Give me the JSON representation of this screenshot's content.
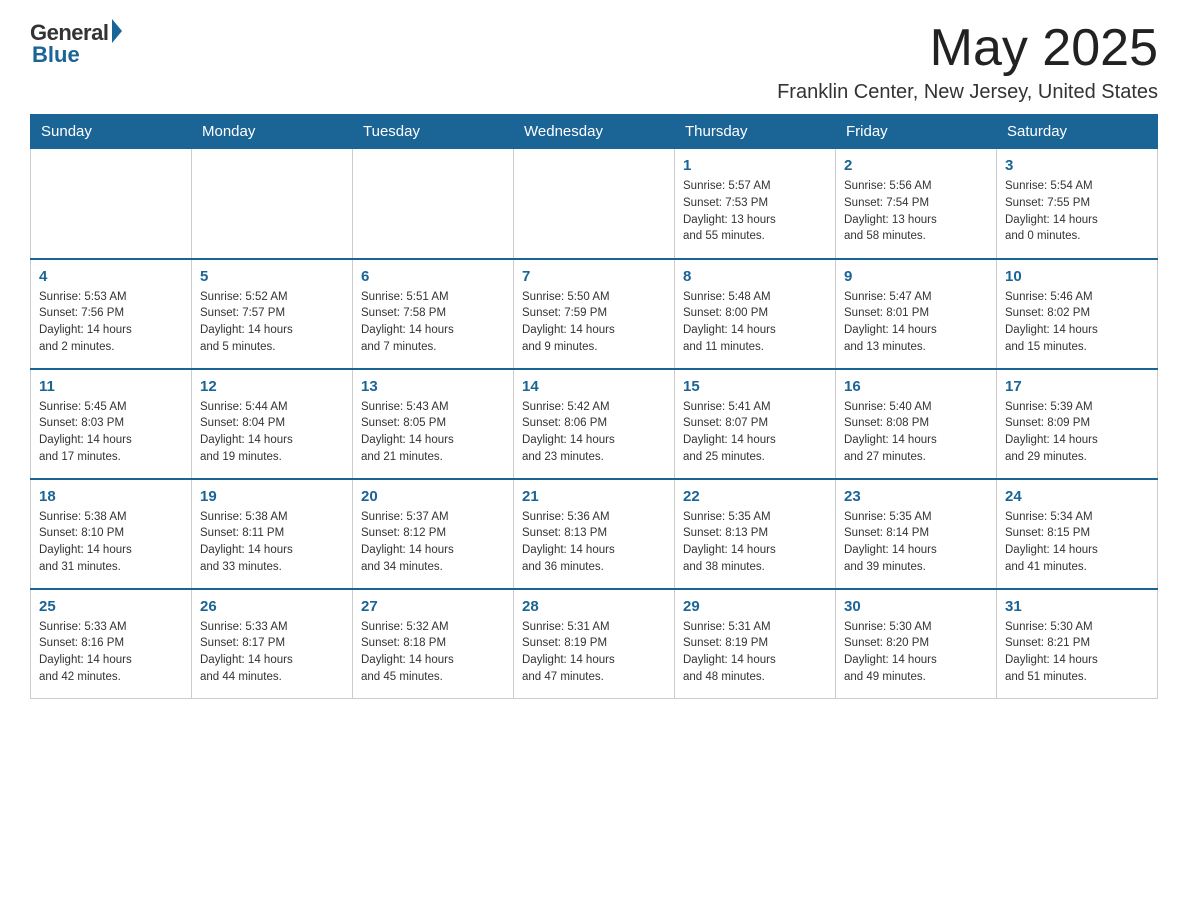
{
  "logo": {
    "general": "General",
    "blue": "Blue"
  },
  "title": {
    "month_year": "May 2025",
    "location": "Franklin Center, New Jersey, United States"
  },
  "headers": [
    "Sunday",
    "Monday",
    "Tuesday",
    "Wednesday",
    "Thursday",
    "Friday",
    "Saturday"
  ],
  "weeks": [
    [
      {
        "day": "",
        "info": ""
      },
      {
        "day": "",
        "info": ""
      },
      {
        "day": "",
        "info": ""
      },
      {
        "day": "",
        "info": ""
      },
      {
        "day": "1",
        "info": "Sunrise: 5:57 AM\nSunset: 7:53 PM\nDaylight: 13 hours\nand 55 minutes."
      },
      {
        "day": "2",
        "info": "Sunrise: 5:56 AM\nSunset: 7:54 PM\nDaylight: 13 hours\nand 58 minutes."
      },
      {
        "day": "3",
        "info": "Sunrise: 5:54 AM\nSunset: 7:55 PM\nDaylight: 14 hours\nand 0 minutes."
      }
    ],
    [
      {
        "day": "4",
        "info": "Sunrise: 5:53 AM\nSunset: 7:56 PM\nDaylight: 14 hours\nand 2 minutes."
      },
      {
        "day": "5",
        "info": "Sunrise: 5:52 AM\nSunset: 7:57 PM\nDaylight: 14 hours\nand 5 minutes."
      },
      {
        "day": "6",
        "info": "Sunrise: 5:51 AM\nSunset: 7:58 PM\nDaylight: 14 hours\nand 7 minutes."
      },
      {
        "day": "7",
        "info": "Sunrise: 5:50 AM\nSunset: 7:59 PM\nDaylight: 14 hours\nand 9 minutes."
      },
      {
        "day": "8",
        "info": "Sunrise: 5:48 AM\nSunset: 8:00 PM\nDaylight: 14 hours\nand 11 minutes."
      },
      {
        "day": "9",
        "info": "Sunrise: 5:47 AM\nSunset: 8:01 PM\nDaylight: 14 hours\nand 13 minutes."
      },
      {
        "day": "10",
        "info": "Sunrise: 5:46 AM\nSunset: 8:02 PM\nDaylight: 14 hours\nand 15 minutes."
      }
    ],
    [
      {
        "day": "11",
        "info": "Sunrise: 5:45 AM\nSunset: 8:03 PM\nDaylight: 14 hours\nand 17 minutes."
      },
      {
        "day": "12",
        "info": "Sunrise: 5:44 AM\nSunset: 8:04 PM\nDaylight: 14 hours\nand 19 minutes."
      },
      {
        "day": "13",
        "info": "Sunrise: 5:43 AM\nSunset: 8:05 PM\nDaylight: 14 hours\nand 21 minutes."
      },
      {
        "day": "14",
        "info": "Sunrise: 5:42 AM\nSunset: 8:06 PM\nDaylight: 14 hours\nand 23 minutes."
      },
      {
        "day": "15",
        "info": "Sunrise: 5:41 AM\nSunset: 8:07 PM\nDaylight: 14 hours\nand 25 minutes."
      },
      {
        "day": "16",
        "info": "Sunrise: 5:40 AM\nSunset: 8:08 PM\nDaylight: 14 hours\nand 27 minutes."
      },
      {
        "day": "17",
        "info": "Sunrise: 5:39 AM\nSunset: 8:09 PM\nDaylight: 14 hours\nand 29 minutes."
      }
    ],
    [
      {
        "day": "18",
        "info": "Sunrise: 5:38 AM\nSunset: 8:10 PM\nDaylight: 14 hours\nand 31 minutes."
      },
      {
        "day": "19",
        "info": "Sunrise: 5:38 AM\nSunset: 8:11 PM\nDaylight: 14 hours\nand 33 minutes."
      },
      {
        "day": "20",
        "info": "Sunrise: 5:37 AM\nSunset: 8:12 PM\nDaylight: 14 hours\nand 34 minutes."
      },
      {
        "day": "21",
        "info": "Sunrise: 5:36 AM\nSunset: 8:13 PM\nDaylight: 14 hours\nand 36 minutes."
      },
      {
        "day": "22",
        "info": "Sunrise: 5:35 AM\nSunset: 8:13 PM\nDaylight: 14 hours\nand 38 minutes."
      },
      {
        "day": "23",
        "info": "Sunrise: 5:35 AM\nSunset: 8:14 PM\nDaylight: 14 hours\nand 39 minutes."
      },
      {
        "day": "24",
        "info": "Sunrise: 5:34 AM\nSunset: 8:15 PM\nDaylight: 14 hours\nand 41 minutes."
      }
    ],
    [
      {
        "day": "25",
        "info": "Sunrise: 5:33 AM\nSunset: 8:16 PM\nDaylight: 14 hours\nand 42 minutes."
      },
      {
        "day": "26",
        "info": "Sunrise: 5:33 AM\nSunset: 8:17 PM\nDaylight: 14 hours\nand 44 minutes."
      },
      {
        "day": "27",
        "info": "Sunrise: 5:32 AM\nSunset: 8:18 PM\nDaylight: 14 hours\nand 45 minutes."
      },
      {
        "day": "28",
        "info": "Sunrise: 5:31 AM\nSunset: 8:19 PM\nDaylight: 14 hours\nand 47 minutes."
      },
      {
        "day": "29",
        "info": "Sunrise: 5:31 AM\nSunset: 8:19 PM\nDaylight: 14 hours\nand 48 minutes."
      },
      {
        "day": "30",
        "info": "Sunrise: 5:30 AM\nSunset: 8:20 PM\nDaylight: 14 hours\nand 49 minutes."
      },
      {
        "day": "31",
        "info": "Sunrise: 5:30 AM\nSunset: 8:21 PM\nDaylight: 14 hours\nand 51 minutes."
      }
    ]
  ]
}
